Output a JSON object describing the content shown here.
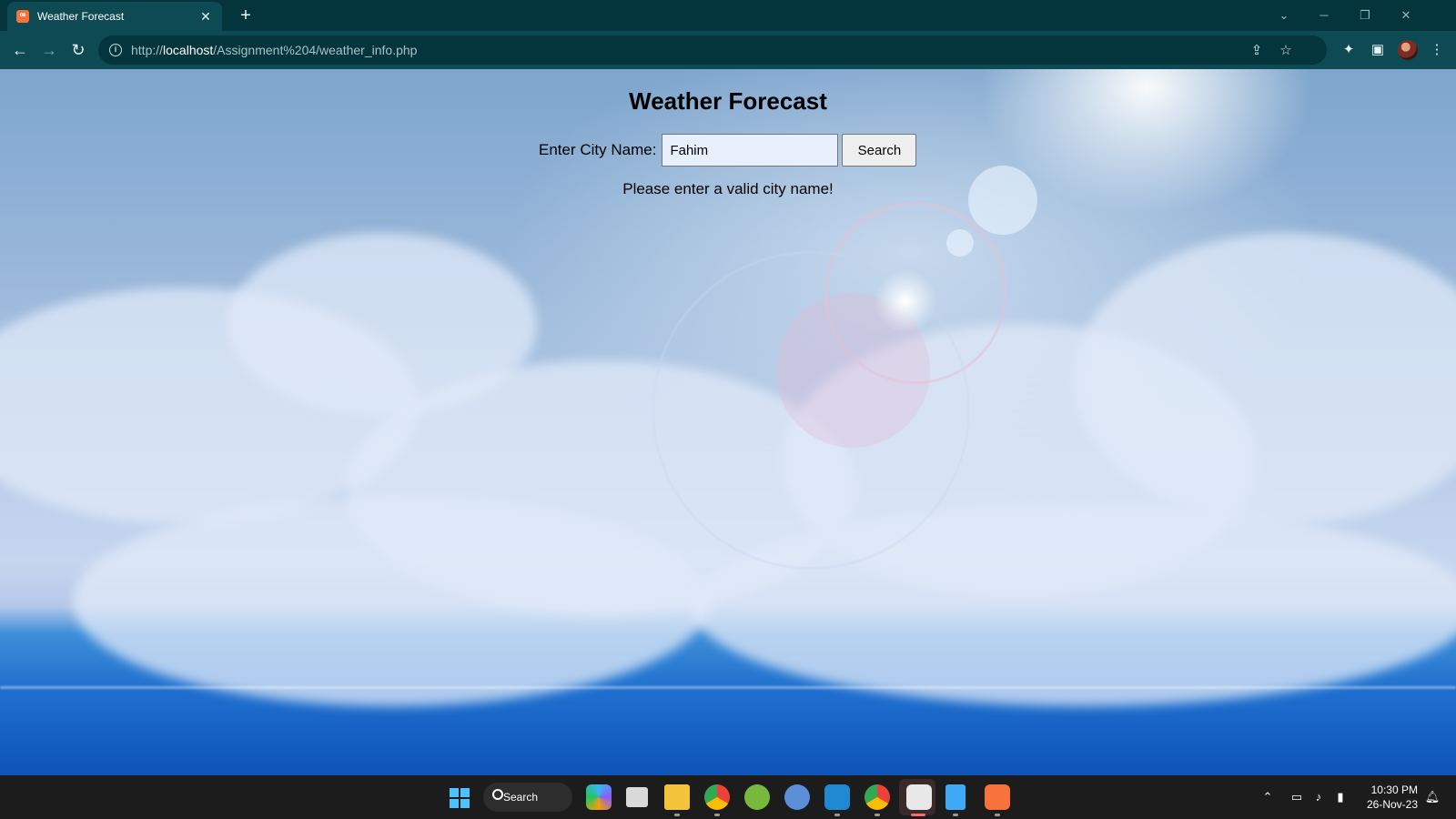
{
  "browser": {
    "tab_title": "Weather Forecast",
    "tab_close": "✕",
    "new_tab": "+",
    "url_prefix": "http://",
    "url_host": "localhost",
    "url_path": "/Assignment%204/weather_info.php"
  },
  "page": {
    "title": "Weather Forecast",
    "form_label": "Enter City Name:",
    "city_input_value": "Fahim",
    "search_button": "Search",
    "message": "Please enter a valid city name!"
  },
  "taskbar": {
    "search_label": "Search",
    "time": "10:30 PM",
    "date": "26-Nov-23"
  },
  "icons": {
    "tab_favicon": "xampp-icon",
    "back": "back-arrow-icon",
    "forward": "forward-arrow-icon",
    "reload": "reload-icon",
    "site_info": "info-icon",
    "share": "share-icon",
    "bookmark": "star-icon",
    "extensions": "puzzle-icon",
    "side_panel": "side-panel-icon",
    "menu": "kebab-menu-icon"
  },
  "colors": {
    "tab_active": "#0e4a54",
    "tabstrip": "#04343c",
    "accent_windows": "#4cc2ff",
    "input_autofill": "#e8f0fe"
  }
}
